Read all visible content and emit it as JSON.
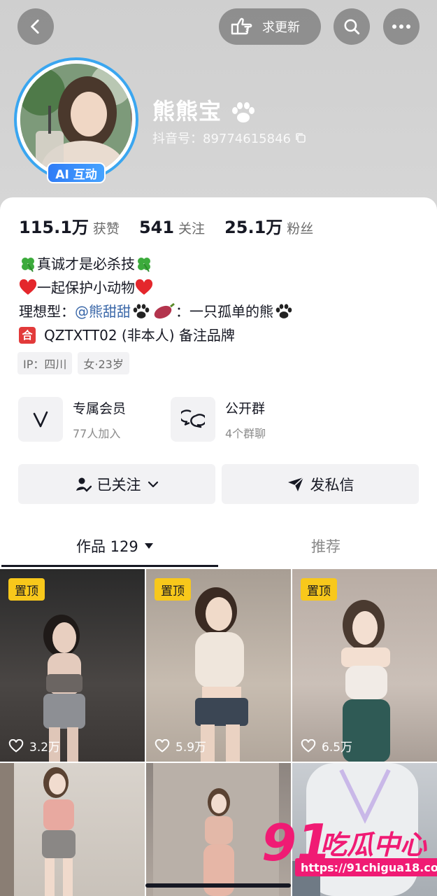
{
  "header": {
    "update_label": "求更新",
    "name": "熊熊宝",
    "douyin_id": "抖音号：89774615846",
    "ai_badge": "AI 互动"
  },
  "stats": [
    {
      "num": "115.1万",
      "label": "获赞"
    },
    {
      "num": "541",
      "label": "关注"
    },
    {
      "num": "25.1万",
      "label": "粉丝"
    }
  ],
  "bio": {
    "line1": "真诚才是必杀技",
    "line2": "一起保护小动物",
    "line3_prefix": "理想型：",
    "line3_mention": "@熊甜甜",
    "line3_suffix": "：一只孤单的熊",
    "line4_icon": "合",
    "line4": "QZTXTT02 (非本人) 备注品牌"
  },
  "tags": [
    "IP：四川",
    "女·23岁"
  ],
  "features": {
    "vip_title": "专属会员",
    "vip_sub": "77人加入",
    "group_title": "公开群",
    "group_sub": "4个群聊"
  },
  "actions": {
    "followed": "已关注",
    "message": "发私信"
  },
  "tabs": {
    "works": "作品 129",
    "recommend": "推荐"
  },
  "videos": [
    {
      "pinned": "置顶",
      "likes": "3.2万"
    },
    {
      "pinned": "置顶",
      "likes": "5.9万"
    },
    {
      "pinned": "置顶",
      "likes": "6.5万"
    },
    {
      "pinned": "",
      "likes": ""
    },
    {
      "pinned": "",
      "likes": ""
    },
    {
      "pinned": "",
      "likes": ""
    }
  ],
  "watermark": {
    "num": "91",
    "text": "吃瓜中心",
    "url": "https://91chigua18.com"
  },
  "colors": {
    "accent_blue": "#3aa6f0",
    "pin_yellow": "#f8c81b",
    "watermark_pink": "#f01b74",
    "mention_blue": "#3a67a8"
  }
}
